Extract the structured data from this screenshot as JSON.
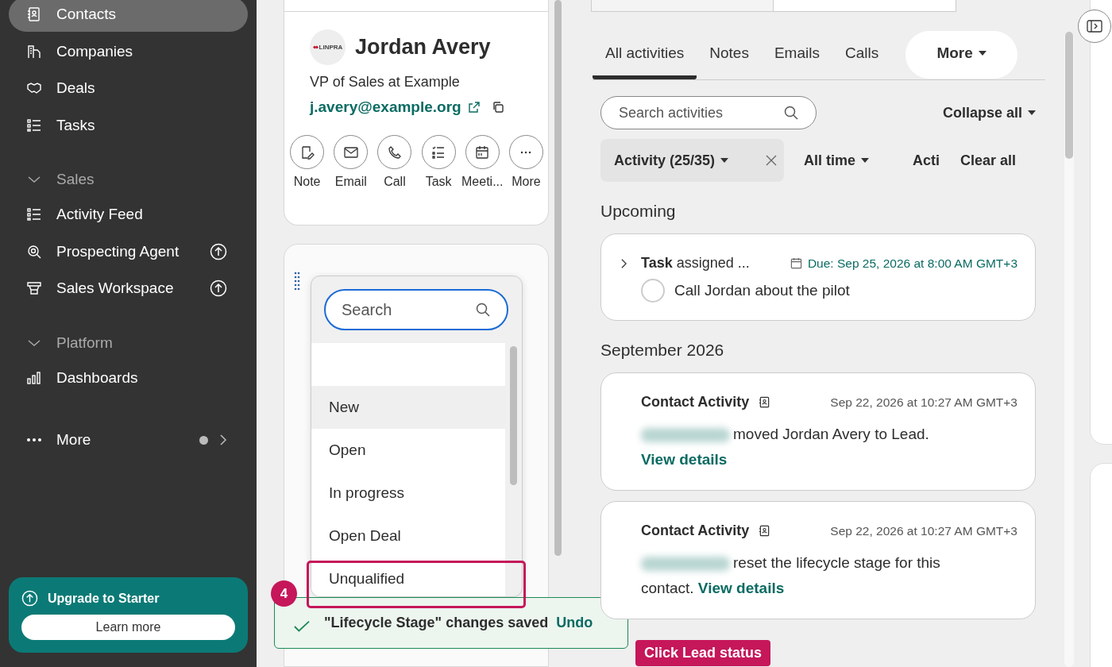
{
  "sidebar": {
    "items": [
      {
        "kind": "link",
        "label": "Contacts",
        "selected": true,
        "upgrade": false
      },
      {
        "kind": "link",
        "label": "Companies",
        "selected": false,
        "upgrade": false
      },
      {
        "kind": "link",
        "label": "Deals",
        "selected": false,
        "upgrade": false
      },
      {
        "kind": "link",
        "label": "Tasks",
        "selected": false,
        "upgrade": false
      },
      {
        "kind": "section",
        "label": "Sales",
        "expanded": true
      },
      {
        "kind": "link",
        "label": "Activity Feed",
        "selected": false,
        "upgrade": false
      },
      {
        "kind": "link",
        "label": "Prospecting Agent",
        "selected": false,
        "upgrade": true
      },
      {
        "kind": "link",
        "label": "Sales Workspace",
        "selected": false,
        "upgrade": true
      },
      {
        "kind": "section",
        "label": "Platform",
        "expanded": true
      },
      {
        "kind": "link",
        "label": "Dashboards",
        "selected": false,
        "upgrade": false
      },
      {
        "kind": "more",
        "label": "More"
      }
    ],
    "upgrade_card": {
      "title": "Upgrade to Starter",
      "button": "Learn more"
    }
  },
  "contact": {
    "logo": "LINPRA",
    "name": "Jordan Avery",
    "title": "VP of Sales at Example",
    "email": "j.avery@example.org",
    "actions": [
      {
        "label": "Note"
      },
      {
        "label": "Email"
      },
      {
        "label": "Call"
      },
      {
        "label": "Task"
      },
      {
        "label": "Meeti..."
      },
      {
        "label": "More"
      }
    ]
  },
  "dropdown": {
    "placeholder": "Search",
    "options": [
      {
        "label": "New",
        "selected": true
      },
      {
        "label": "Open",
        "selected": false
      },
      {
        "label": "In progress",
        "selected": false
      },
      {
        "label": "Open Deal",
        "selected": false
      },
      {
        "label": "Unqualified",
        "selected": false
      }
    ]
  },
  "toast": {
    "message": "\"Lifecycle Stage\" changes saved",
    "action": "Undo"
  },
  "tutorial": {
    "step": "4",
    "callout": "Click Lead status"
  },
  "activities": {
    "tabs": [
      {
        "label": "All activities",
        "selected": true
      },
      {
        "label": "Notes",
        "selected": false
      },
      {
        "label": "Emails",
        "selected": false
      },
      {
        "label": "Calls",
        "selected": false
      },
      {
        "label": "More",
        "selected": false
      }
    ],
    "search": {
      "placeholder": "Search activities"
    },
    "collapse": "Collapse all",
    "filters": [
      {
        "kind": "chip",
        "label": "Activity (25/35)"
      },
      {
        "kind": "dropdown",
        "label": "All time"
      },
      {
        "kind": "plain",
        "label": "Acti"
      }
    ],
    "clear": "Clear all",
    "sections": [
      {
        "heading": "Upcoming",
        "items": [
          {
            "kind": "task",
            "title": "**Task** assigned ...",
            "due": "Due: Sep 25, 2026 at 8:00 AM GMT+3",
            "text": "Call Jordan about the pilot",
            "completed": false
          }
        ]
      },
      {
        "heading": "September 2026",
        "items": [
          {
            "kind": "contact_activity",
            "title": "Contact Activity",
            "time": "Sep 22, 2026 at 10:27 AM GMT+3",
            "text": "moved Jordan Avery to Lead.",
            "link": "View details"
          },
          {
            "kind": "contact_activity",
            "title": "Contact Activity",
            "time": "Sep 22, 2026 at 10:27 AM GMT+3",
            "text": "reset the lifecycle stage for this contact.",
            "link": "View details"
          }
        ]
      }
    ]
  }
}
